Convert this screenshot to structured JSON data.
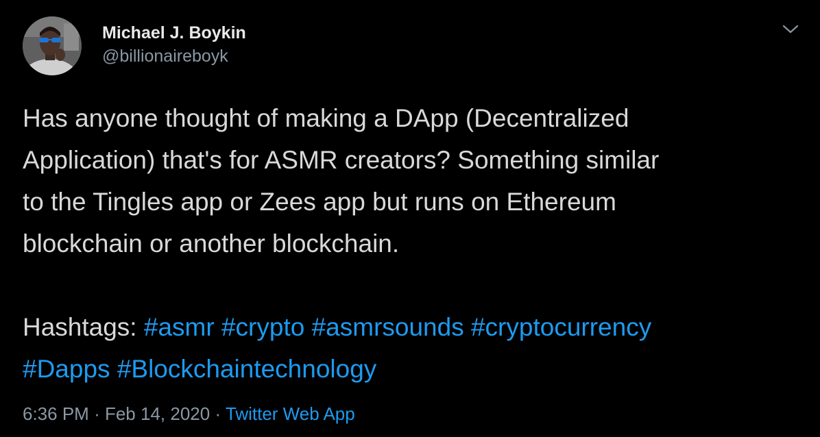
{
  "author": {
    "display_name": "Michael J. Boykin",
    "handle": "@billionaireboyk",
    "avatar_icon": "user-avatar-photo"
  },
  "menu": {
    "icon": "chevron-down-icon"
  },
  "tweet": {
    "lines": [
      "Has anyone thought of making a DApp (Decentralized",
      "Application) that's for ASMR creators? Something similar",
      "to the Tingles app or Zees app but runs on Ethereum",
      "blockchain or another blockchain."
    ],
    "hashtags_label": "Hashtags:",
    "hashtags": [
      "#asmr",
      "#crypto",
      "#asmrsounds",
      "#cryptocurrency",
      "#Dapps",
      "#Blockchaintechnology"
    ]
  },
  "meta": {
    "time": "6:36 PM",
    "separator": "·",
    "date": "Feb 14, 2020",
    "source": "Twitter Web App"
  },
  "colors": {
    "background": "#000000",
    "text": "#d9d9d9",
    "secondary": "#8b98a5",
    "link": "#1d9bf0"
  }
}
